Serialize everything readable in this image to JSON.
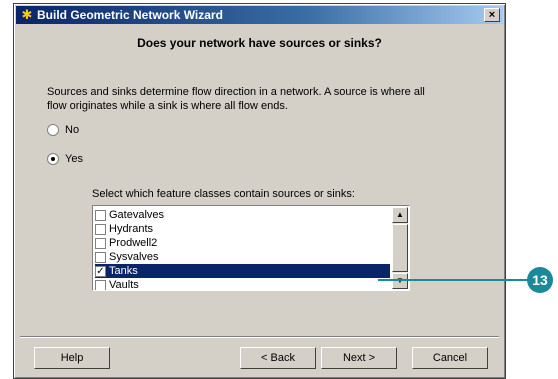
{
  "window": {
    "title": "Build Geometric Network Wizard",
    "close_label": "×"
  },
  "heading": "Does your network have sources or sinks?",
  "description": "Sources and sinks determine flow direction in a network. A source is where all flow originates while a sink is where all flow ends.",
  "options": [
    {
      "label": "No",
      "checked": false
    },
    {
      "label": "Yes",
      "checked": true
    }
  ],
  "list": {
    "label": "Select which feature classes contain sources or sinks:",
    "items": [
      {
        "label": "Gatevalves",
        "checked": false,
        "selected": false
      },
      {
        "label": "Hydrants",
        "checked": false,
        "selected": false
      },
      {
        "label": "Prodwell2",
        "checked": false,
        "selected": false
      },
      {
        "label": "Sysvalves",
        "checked": false,
        "selected": false
      },
      {
        "label": "Tanks",
        "checked": true,
        "selected": true
      },
      {
        "label": "Vaults",
        "checked": false,
        "selected": false
      }
    ]
  },
  "buttons": {
    "help": "Help",
    "back": "< Back",
    "next": "Next >",
    "cancel": "Cancel"
  },
  "callout": {
    "number": "13",
    "color": "#1a8a9a"
  }
}
